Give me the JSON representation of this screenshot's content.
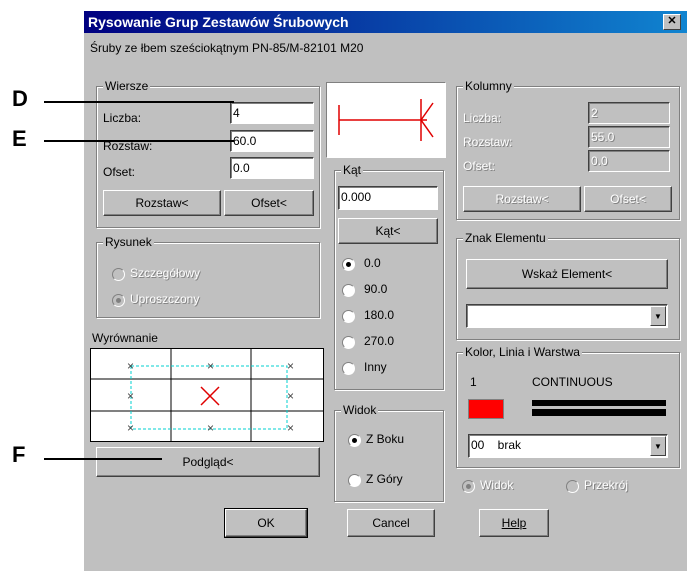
{
  "title": "Rysowanie Grup Zestawów Śrubowych",
  "subtitle": "Śruby ze łbem sześciokątnym   PN-85/M-82101   M20",
  "rows_group": {
    "title": "Wiersze",
    "count_label": "Liczba:",
    "count_value": "4",
    "spacing_label": "Rozstaw:",
    "spacing_value": "60.0",
    "offset_label": "Ofset:",
    "offset_value": "0.0",
    "spacing_button": "Rozstaw<",
    "offset_button": "Ofset<"
  },
  "columns_group": {
    "title": "Kolumny",
    "count_label": "Liczba:",
    "count_value": "2",
    "spacing_label": "Rozstaw:",
    "spacing_value": "55.0",
    "offset_label": "Ofset:",
    "offset_value": "0.0",
    "spacing_button": "Rozstaw<",
    "offset_button": "Ofset<"
  },
  "drawing_group": {
    "title": "Rysunek",
    "options": [
      "Szczegółowy",
      "Uproszczony"
    ],
    "selected": "Uproszczony"
  },
  "alignment": {
    "label": "Wyrównanie"
  },
  "preview_button": "Podgląd<",
  "angle_group": {
    "title": "Kąt",
    "value": "0.000",
    "button": "Kąt<",
    "options": [
      "0.0",
      "90.0",
      "180.0",
      "270.0",
      "Inny"
    ],
    "selected": "0.0"
  },
  "view_group": {
    "title": "Widok",
    "options": [
      "Z Boku",
      "Z Góry"
    ],
    "selected": "Z Boku"
  },
  "element_group": {
    "title": "Znak Elementu",
    "button": "Wskaż Element<",
    "dropdown_value": ""
  },
  "color_group": {
    "title": "Kolor, Linia i Warstwa",
    "color_number": "1",
    "linetype": "CONTINUOUS",
    "color_swatch": "#ff0000",
    "layer_value": "00    brak"
  },
  "bottom_radios": {
    "options": [
      "Widok",
      "Przekrój"
    ]
  },
  "buttons": {
    "ok": "OK",
    "cancel": "Cancel",
    "help": "Help"
  },
  "annotations": {
    "d": "D",
    "e": "E",
    "f": "F"
  }
}
